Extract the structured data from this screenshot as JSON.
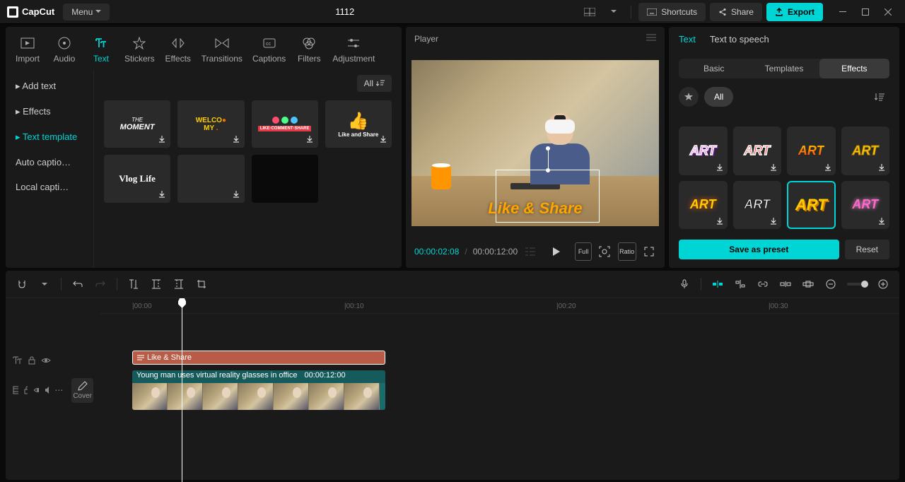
{
  "app": {
    "name": "CapCut",
    "menu": "Menu",
    "title": "1112"
  },
  "topbar": {
    "shortcuts": "Shortcuts",
    "share": "Share",
    "export": "Export"
  },
  "top_tabs": [
    {
      "label": "Import"
    },
    {
      "label": "Audio"
    },
    {
      "label": "Text"
    },
    {
      "label": "Stickers"
    },
    {
      "label": "Effects"
    },
    {
      "label": "Transitions"
    },
    {
      "label": "Captions"
    },
    {
      "label": "Filters"
    },
    {
      "label": "Adjustment"
    }
  ],
  "side_items": [
    {
      "label": "Add text",
      "caret": true
    },
    {
      "label": "Effects",
      "caret": true
    },
    {
      "label": "Text template",
      "caret": true,
      "active": true
    },
    {
      "label": "Auto captio…"
    },
    {
      "label": "Local capti…"
    }
  ],
  "thumb_filter": "All",
  "thumbs": [
    {
      "style": "moment",
      "line1": "THE",
      "line2": "MOMENT"
    },
    {
      "style": "welcome",
      "line1": "WELCO",
      "line2": "MY"
    },
    {
      "style": "likebar",
      "bar": "LIKE·COMMENT·SHARE"
    },
    {
      "style": "thumbs",
      "txt": "Like and Share"
    },
    {
      "style": "cursive",
      "txt": "Vlog Life"
    },
    {
      "style": "blank"
    },
    {
      "style": "blankdark"
    },
    {
      "style": "abc"
    }
  ],
  "player": {
    "header": "Player",
    "overlay_text": "Like & Share",
    "time_current": "00:00:02:08",
    "time_total": "00:00:12:00",
    "full": "Full",
    "ratio": "Ratio"
  },
  "right": {
    "tabs": [
      {
        "label": "Text",
        "active": true
      },
      {
        "label": "Text to speech"
      }
    ],
    "subtabs": [
      {
        "label": "Basic"
      },
      {
        "label": "Templates"
      },
      {
        "label": "Effects",
        "active": true
      }
    ],
    "filter_all": "All",
    "art_label": "ART",
    "preset_styles": [
      {
        "fill": "#e466d8",
        "stroke": "#fff",
        "shadow": "#6a1b9a"
      },
      {
        "fill": "#ff3b3b",
        "stroke": "#fff"
      },
      {
        "grad": "red-yellow"
      },
      {
        "fill": "#ffcc00",
        "stroke": "#b8860b"
      },
      {
        "fill": "#ffcc00",
        "glow": "#ff6600"
      },
      {
        "fill": "#fff",
        "stroke": "#222"
      },
      {
        "fill": "#ffcc00",
        "bold3d": true,
        "selected": true
      },
      {
        "fill": "#ff66cc",
        "glow": "#ff99dd"
      }
    ],
    "save": "Save as preset",
    "reset": "Reset"
  },
  "timeline": {
    "ticks": [
      "|00:00",
      "|00:10",
      "|00:20",
      "|00:30"
    ],
    "playhead_pct": 18.5,
    "text_clip": {
      "label": "Like & Share",
      "left_pct": 12.5,
      "width_pct": 91
    },
    "video_clip": {
      "title": "Young man uses virtual reality glasses in office",
      "duration": "00:00:12:00",
      "left_pct": 12.5,
      "width_pct": 91
    },
    "cover_label": "Cover"
  }
}
